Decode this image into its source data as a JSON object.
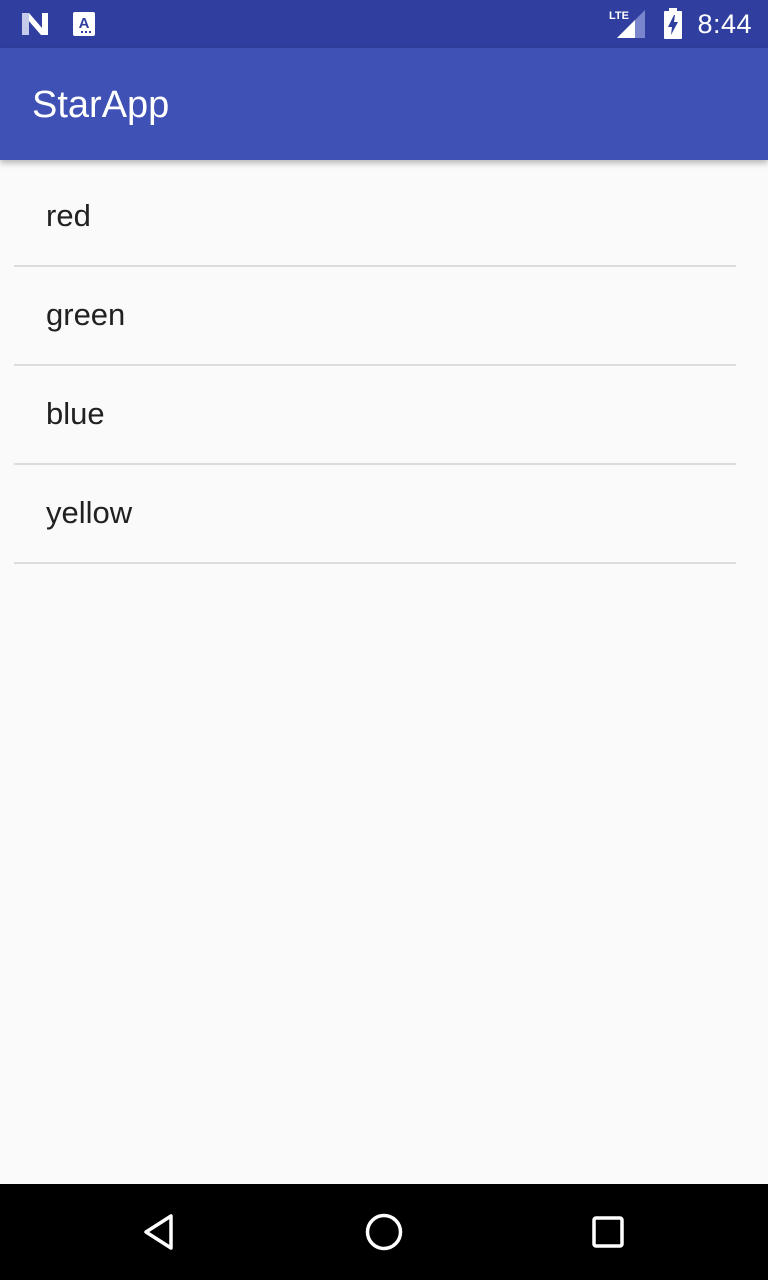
{
  "status_bar": {
    "time": "8:44",
    "network_label": "LTE",
    "icons": [
      "n-notification-icon",
      "a-notification-icon",
      "lte-signal-icon",
      "battery-charging-icon"
    ]
  },
  "app_bar": {
    "title": "StarApp"
  },
  "list": {
    "items": [
      {
        "label": "red"
      },
      {
        "label": "green"
      },
      {
        "label": "blue"
      },
      {
        "label": "yellow"
      }
    ]
  },
  "nav_bar": {
    "icons": [
      "back-icon",
      "home-icon",
      "recents-icon"
    ]
  },
  "colors": {
    "status_bar": "#303f9f",
    "app_bar": "#3f51b5",
    "background": "#fafafa",
    "divider": "#dcdcdc",
    "text": "#212121"
  }
}
